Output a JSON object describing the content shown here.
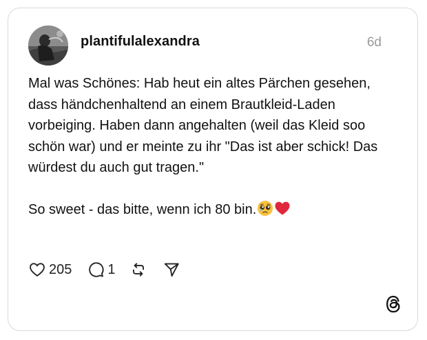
{
  "post": {
    "username": "plantifulalexandra",
    "timestamp": "6d",
    "paragraph1": "Mal was Schönes: Hab heut ein altes Pärchen gesehen, dass händchenhaltend an einem Brautkleid-Laden vorbeiging. Haben dann angehalten (weil das Kleid soo schön war) und er meinte zu ihr \"Das ist aber schick! Das würdest du auch gut tragen.\"",
    "paragraph2": "So sweet - das bitte, wenn ich 80 bin.",
    "emojis": [
      "pleading-face-emoji",
      "red-heart-emoji"
    ]
  },
  "actions": {
    "likes": "205",
    "replies": "1"
  },
  "icons": {
    "like": "heart-icon",
    "reply": "speech-bubble-icon",
    "repost": "repost-icon",
    "share": "send-icon",
    "brand": "threads-logo"
  },
  "colors": {
    "text": "#111111",
    "muted": "#999999",
    "border": "#d9d9d9",
    "heart_emoji": "#e0283c",
    "pleading_face": "#f7c23e"
  }
}
